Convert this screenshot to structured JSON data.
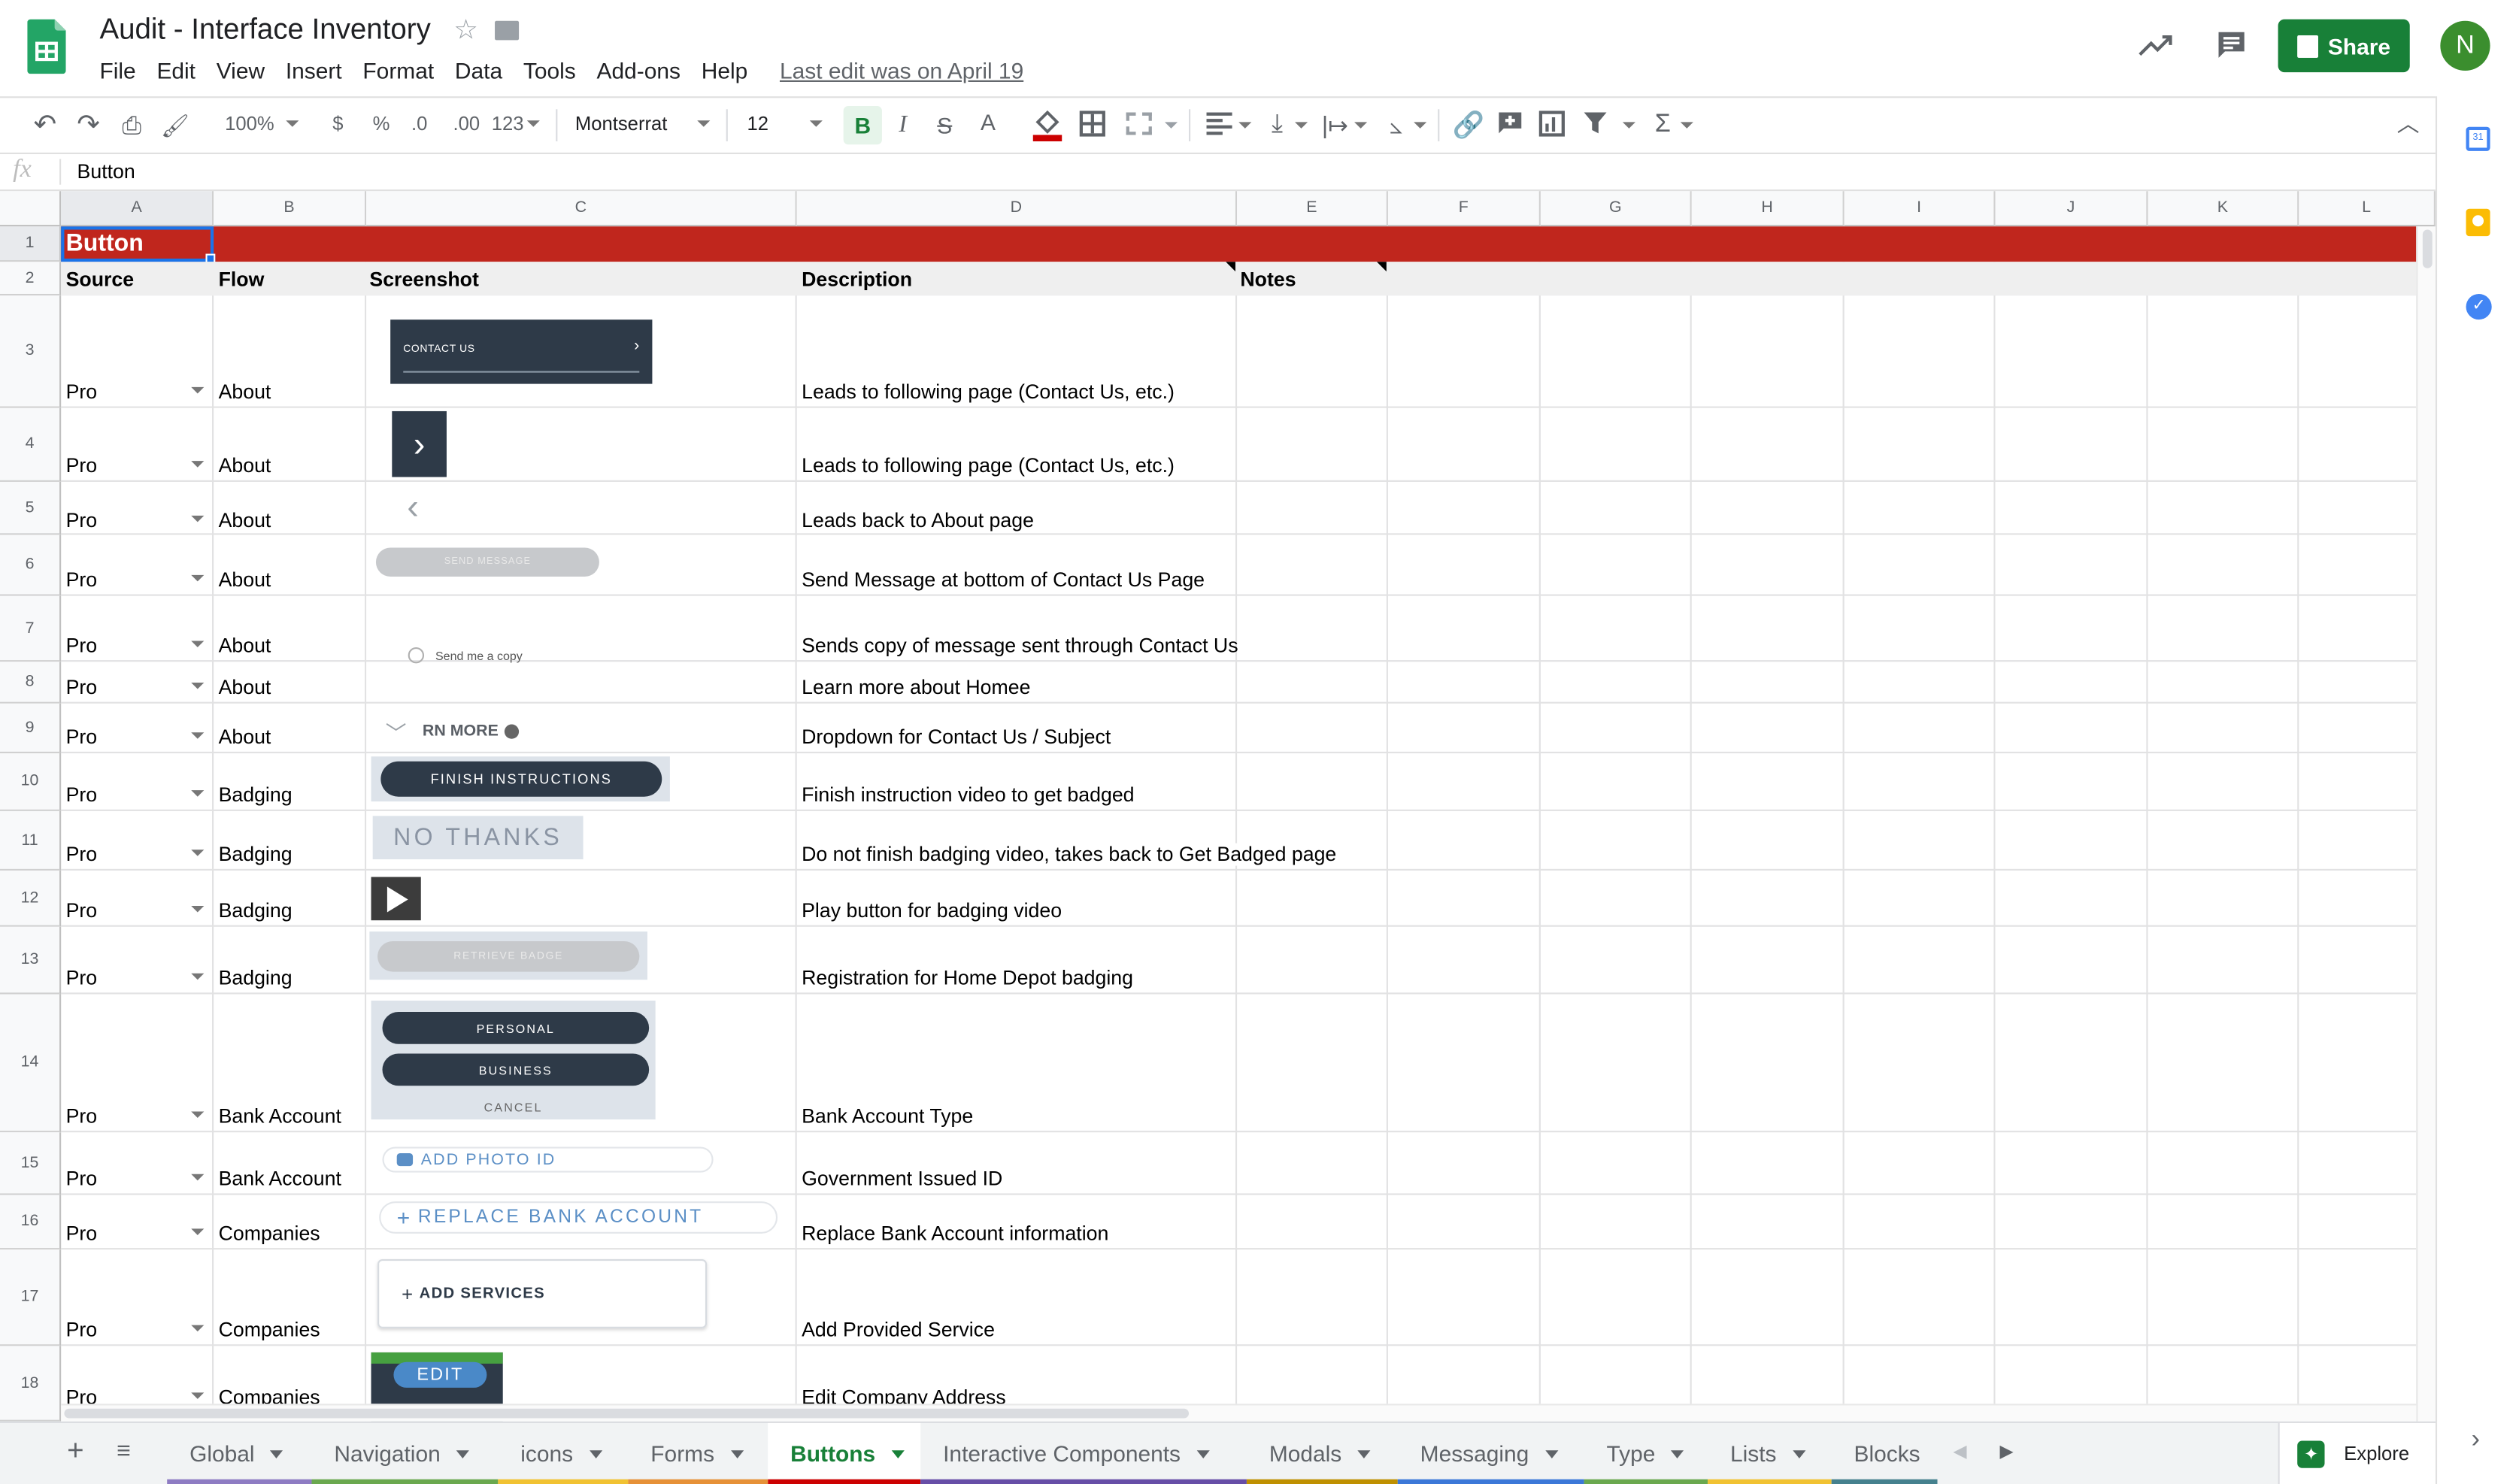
{
  "doc": {
    "title": "Audit - Interface Inventory",
    "last_edit": "Last edit was on April 19",
    "star_icon": "star-icon",
    "folder_icon": "folder-icon"
  },
  "menu": [
    "File",
    "Edit",
    "View",
    "Insert",
    "Format",
    "Data",
    "Tools",
    "Add-ons",
    "Help"
  ],
  "header_right": {
    "share_label": "Share",
    "avatar_initial": "N",
    "brand_green": "#188038"
  },
  "toolbar": {
    "zoom": "100%",
    "currency": "$",
    "percent": "%",
    "dec_less": ".0",
    "dec_more": ".00",
    "more_formats": "123",
    "font": "Montserrat",
    "font_size": "12",
    "bold": "B",
    "italic": "I",
    "strike": "S",
    "text_color": "A"
  },
  "formula_bar": {
    "fx": "fx",
    "value": "Button"
  },
  "columns": [
    "A",
    "B",
    "C",
    "D",
    "E",
    "F",
    "G",
    "H",
    "I",
    "J",
    "K",
    "L"
  ],
  "row_numbers": [
    "1",
    "2",
    "3",
    "4",
    "5",
    "6",
    "7",
    "8",
    "9",
    "10",
    "11",
    "12",
    "13",
    "14",
    "15",
    "16",
    "17",
    "18"
  ],
  "sheet": {
    "section_title": "Button",
    "section_color": "#c0261d",
    "headers": {
      "source": "Source",
      "flow": "Flow",
      "screenshot": "Screenshot",
      "description": "Description",
      "notes": "Notes"
    },
    "rows": [
      {
        "source": "Pro",
        "flow": "About",
        "description": "Leads to following page (Contact Us, etc.)"
      },
      {
        "source": "Pro",
        "flow": "About",
        "description": "Leads to following page (Contact Us, etc.)"
      },
      {
        "source": "Pro",
        "flow": "About",
        "description": "Leads back to About page"
      },
      {
        "source": "Pro",
        "flow": "About",
        "description": "Send Message at bottom of Contact Us Page"
      },
      {
        "source": "Pro",
        "flow": "About",
        "description": "Sends copy of message sent through Contact Us"
      },
      {
        "source": "Pro",
        "flow": "About",
        "description": "Learn more about Homee"
      },
      {
        "source": "Pro",
        "flow": "About",
        "description": "Dropdown for Contact Us / Subject"
      },
      {
        "source": "Pro",
        "flow": "Badging",
        "description": "Finish instruction video to get badged"
      },
      {
        "source": "Pro",
        "flow": "Badging",
        "description": "Do not finish badging video, takes back to Get Badged page"
      },
      {
        "source": "Pro",
        "flow": "Badging",
        "description": "Play button for badging video"
      },
      {
        "source": "Pro",
        "flow": "Badging",
        "description": "Registration for Home Depot badging"
      },
      {
        "source": "Pro",
        "flow": "Bank Account",
        "description": "Bank Account Type"
      },
      {
        "source": "Pro",
        "flow": "Bank Account",
        "description": "Government Issued ID"
      },
      {
        "source": "Pro",
        "flow": "Companies",
        "description": "Replace Bank Account information"
      },
      {
        "source": "Pro",
        "flow": "Companies",
        "description": "Add Provided Service"
      },
      {
        "source": "Pro",
        "flow": "Companies",
        "description": "Edit Company Address"
      }
    ]
  },
  "screenshots": {
    "contact_us": "CONTACT US",
    "send_message": "SEND MESSAGE",
    "send_copy": "Send me a copy",
    "learn_more": "RN MORE",
    "finish_instructions": "FINISH INSTRUCTIONS",
    "no_thanks": "NO THANKS",
    "retrieve_badge": "RETRIEVE BADGE",
    "personal": "PERSONAL",
    "business": "BUSINESS",
    "cancel": "CANCEL",
    "add_photo_id": "ADD PHOTO ID",
    "replace_bank": "REPLACE BANK ACCOUNT",
    "add_services": "ADD SERVICES",
    "edit": "EDIT"
  },
  "tabs": [
    {
      "label": "Global",
      "color": "#8e7cc3"
    },
    {
      "label": "Navigation",
      "color": "#6aa84f"
    },
    {
      "label": "icons",
      "color": "#f1c232"
    },
    {
      "label": "Forms",
      "color": "#e69138"
    },
    {
      "label": "Buttons",
      "color": "#cc0000"
    },
    {
      "label": "Interactive Components",
      "color": "#674ea7"
    },
    {
      "label": "Modals",
      "color": "#bf9000"
    },
    {
      "label": "Messaging",
      "color": "#3c78d8"
    },
    {
      "label": "Type",
      "color": "#6aa84f"
    },
    {
      "label": "Lists",
      "color": "#f1c232"
    },
    {
      "label": "Blocks",
      "color": "#45818e"
    }
  ],
  "active_tab": "Buttons",
  "explore_label": "Explore"
}
